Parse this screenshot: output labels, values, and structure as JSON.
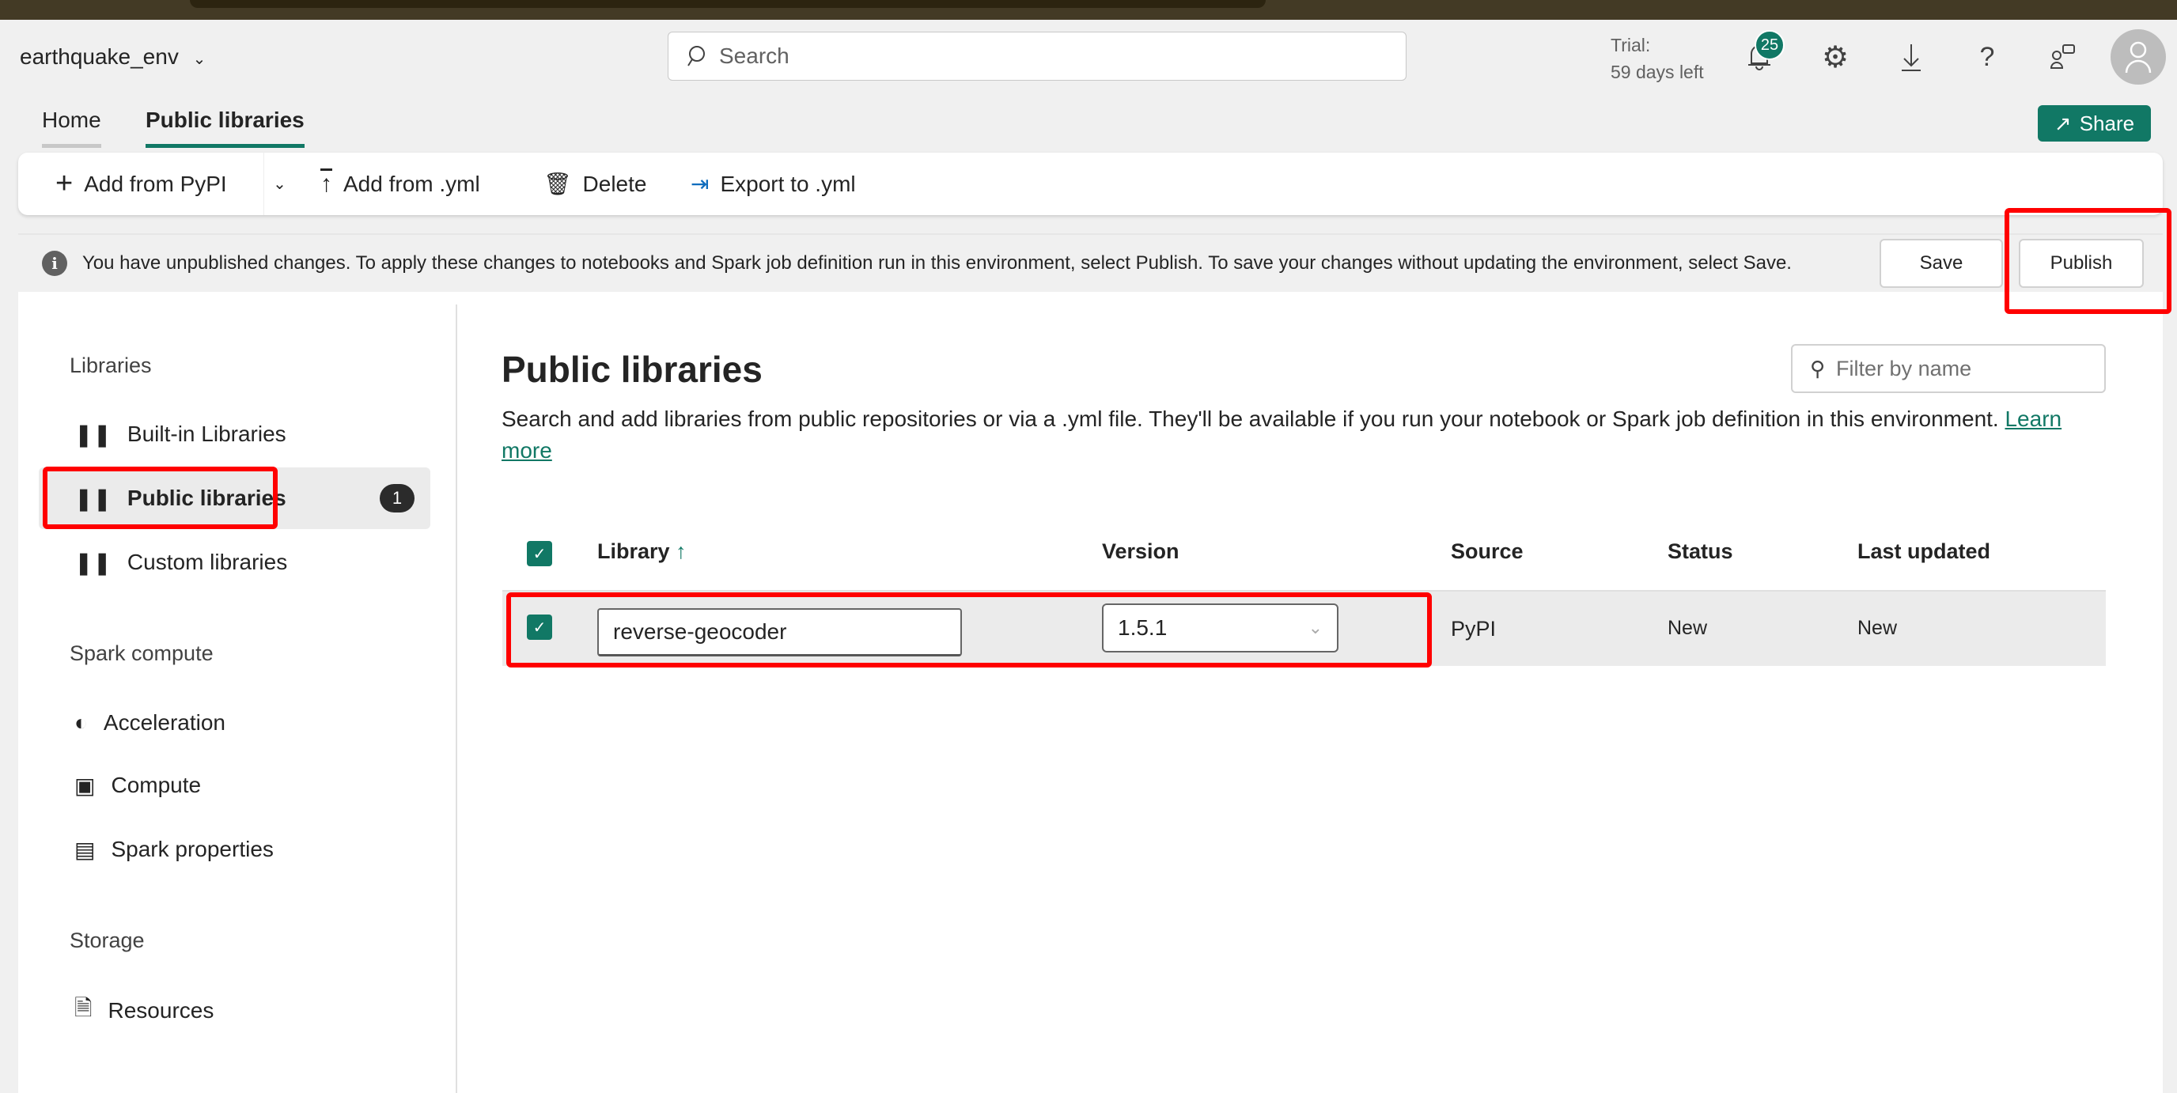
{
  "header": {
    "env_name": "earthquake_env",
    "search_placeholder": "Search",
    "trial_line1": "Trial:",
    "trial_line2": "59 days left",
    "notification_count": "25",
    "share_label": "Share"
  },
  "tabs": [
    {
      "label": "Home"
    },
    {
      "label": "Public libraries"
    }
  ],
  "toolbar": {
    "add_pypi": "Add from PyPI",
    "add_yml": "Add from .yml",
    "delete": "Delete",
    "export_yml": "Export to .yml"
  },
  "message": {
    "text": "You have unpublished changes. To apply these changes to notebooks and Spark job definition run in this environment, select Publish. To save your changes without updating the environment, select Save.",
    "save_label": "Save",
    "publish_label": "Publish"
  },
  "sidebar": {
    "sections": [
      {
        "title": "Libraries",
        "items": [
          {
            "label": "Built-in Libraries"
          },
          {
            "label": "Public libraries",
            "badge": "1",
            "selected": true
          },
          {
            "label": "Custom libraries"
          }
        ]
      },
      {
        "title": "Spark compute",
        "items": [
          {
            "label": "Acceleration"
          },
          {
            "label": "Compute"
          },
          {
            "label": "Spark properties"
          }
        ]
      },
      {
        "title": "Storage",
        "items": [
          {
            "label": "Resources"
          }
        ]
      }
    ]
  },
  "main": {
    "title": "Public libraries",
    "description": "Search and add libraries from public repositories or via a .yml file. They'll be available if you run your notebook or Spark job definition in this environment.",
    "learn_more": "Learn more",
    "filter_placeholder": "Filter by name",
    "table": {
      "columns": [
        "Library",
        "Version",
        "Source",
        "Status",
        "Last updated"
      ],
      "sort_indicator": "↑",
      "rows": [
        {
          "library": "reverse-geocoder",
          "version": "1.5.1",
          "source": "PyPI",
          "status": "New",
          "last_updated": "New",
          "checked": true
        }
      ]
    }
  },
  "colors": {
    "accent": "#117865",
    "highlight": "#ff0000"
  }
}
